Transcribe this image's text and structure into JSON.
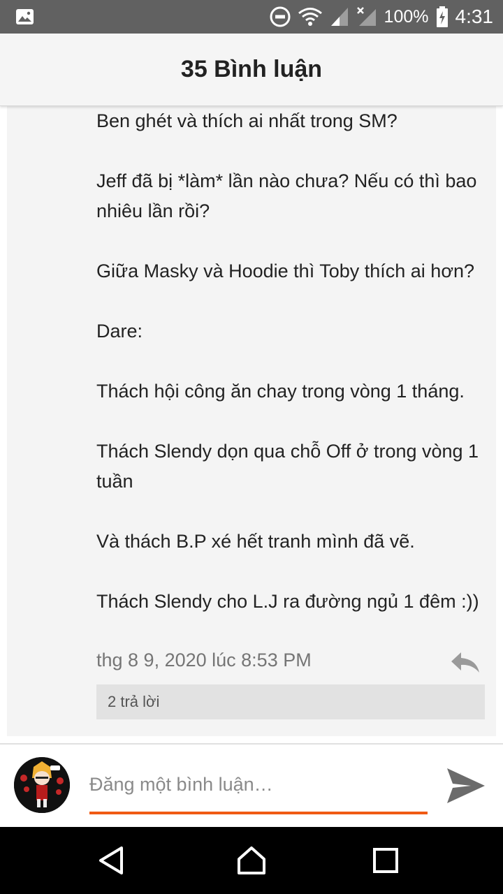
{
  "status_bar": {
    "battery": "100%",
    "time": "4:31",
    "icons": [
      "image-icon",
      "do-not-disturb-icon",
      "wifi-icon",
      "signal-icon",
      "no-signal-icon",
      "battery-charging-icon"
    ]
  },
  "header": {
    "title": "35 Bình luận"
  },
  "comment": {
    "paragraphs": [
      "Ben ghét và thích ai nhất trong SM?",
      "Jeff đã bị *làm* lần nào chưa? Nếu có thì bao nhiêu lần rồi?",
      "Giữa Masky và Hoodie thì Toby thích ai hơn?",
      "Dare:",
      "Thách hội công ăn chay trong vòng 1 tháng.",
      "Thách Slendy dọn qua chỗ Off ở trong vòng 1 tuần",
      "Và thách B.P xé hết tranh mình đã vẽ.",
      "Thách Slendy cho L.J ra đường ngủ 1 đêm :))"
    ],
    "timestamp": "thg 8 9, 2020 lúc 8:53 PM",
    "replies_label": "2 trả lời"
  },
  "composer": {
    "placeholder": "Đăng một bình luận…",
    "value": ""
  },
  "colors": {
    "accent": "#f05a14",
    "status_bar": "#616161",
    "header_bg": "#f5f5f5",
    "card_bg": "#f4f4f4",
    "replies_bg": "#e2e2e2"
  },
  "nav": {
    "icons": [
      "back-icon",
      "home-icon",
      "recents-icon"
    ]
  }
}
